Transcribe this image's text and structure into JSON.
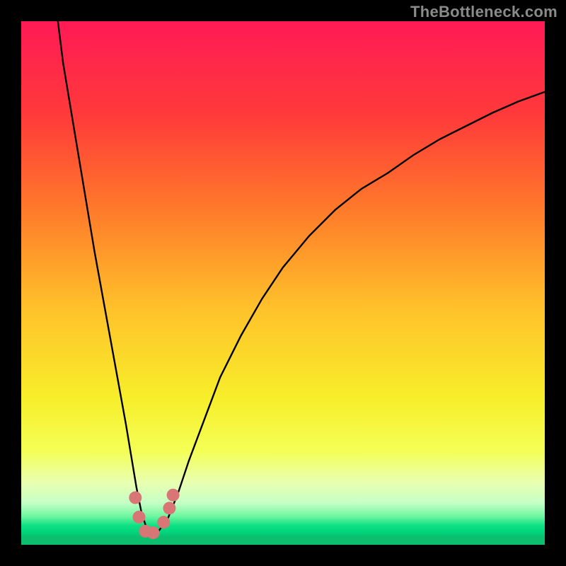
{
  "watermark": "TheBottleneck.com",
  "colors": {
    "background": "#000000",
    "curve_stroke": "#000000",
    "marker_fill": "#d77674",
    "gradient_stops": [
      {
        "offset": 0.0,
        "color": "#ff1a55"
      },
      {
        "offset": 0.18,
        "color": "#ff3a3a"
      },
      {
        "offset": 0.36,
        "color": "#ff7a2a"
      },
      {
        "offset": 0.55,
        "color": "#ffc22a"
      },
      {
        "offset": 0.72,
        "color": "#f7ee2a"
      },
      {
        "offset": 0.82,
        "color": "#f4ff55"
      },
      {
        "offset": 0.88,
        "color": "#e9ffb0"
      },
      {
        "offset": 0.92,
        "color": "#c6ffc6"
      },
      {
        "offset": 0.945,
        "color": "#70f7a0"
      },
      {
        "offset": 0.963,
        "color": "#10e084"
      },
      {
        "offset": 0.975,
        "color": "#00d67c"
      },
      {
        "offset": 0.985,
        "color": "#0bbf6f"
      },
      {
        "offset": 1.0,
        "color": "#0bbf6f"
      }
    ]
  },
  "chart_data": {
    "type": "line",
    "title": "",
    "xlabel": "",
    "ylabel": "",
    "xlim": [
      0,
      100
    ],
    "ylim": [
      0,
      100
    ],
    "grid": false,
    "legend": false,
    "series": [
      {
        "name": "bottleneck-curve",
        "x": [
          7,
          8,
          10,
          12,
          14,
          16,
          18,
          20,
          21,
          22,
          23,
          24,
          25,
          26,
          28,
          30,
          32,
          35,
          38,
          42,
          46,
          50,
          55,
          60,
          65,
          70,
          75,
          80,
          85,
          90,
          95,
          100
        ],
        "y": [
          100,
          92,
          80,
          68,
          56,
          45,
          34,
          23,
          17,
          11,
          6,
          3,
          2,
          2.3,
          5,
          10,
          16,
          24,
          32,
          40,
          47,
          53,
          59,
          64,
          68,
          71,
          74.5,
          77.5,
          80,
          82.5,
          84.7,
          86.5
        ]
      }
    ],
    "markers": [
      {
        "x": 21.8,
        "y": 9.0
      },
      {
        "x": 22.5,
        "y": 5.3
      },
      {
        "x": 23.7,
        "y": 2.6
      },
      {
        "x": 25.2,
        "y": 2.3
      },
      {
        "x": 27.2,
        "y": 4.3
      },
      {
        "x": 28.3,
        "y": 7.0
      },
      {
        "x": 29.0,
        "y": 9.5
      }
    ],
    "marker_radius_px": 9
  }
}
